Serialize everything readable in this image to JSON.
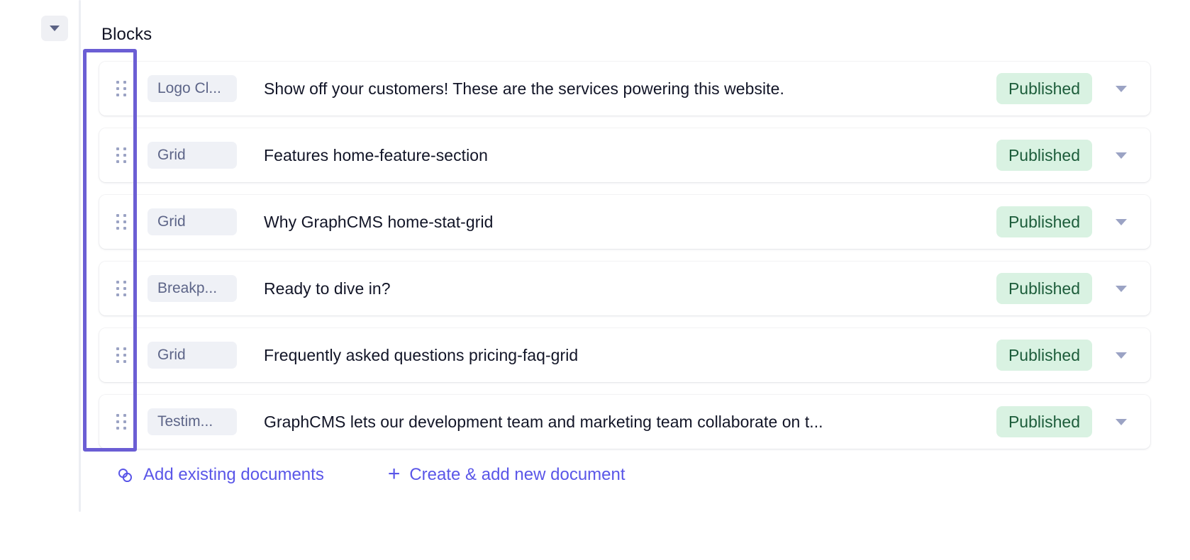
{
  "field": {
    "label": "Blocks",
    "collapse_icon": "triangle-down-icon"
  },
  "rows": [
    {
      "drag_icon": "drag-handle-icon",
      "type": "Logo Cl...",
      "title": "Show off your customers! These are the services powering this website.",
      "status": "Published",
      "menu_icon": "chevron-down-icon"
    },
    {
      "drag_icon": "drag-handle-icon",
      "type": "Grid",
      "title": "Features home-feature-section",
      "status": "Published",
      "menu_icon": "chevron-down-icon"
    },
    {
      "drag_icon": "drag-handle-icon",
      "type": "Grid",
      "title": "Why GraphCMS home-stat-grid",
      "status": "Published",
      "menu_icon": "chevron-down-icon"
    },
    {
      "drag_icon": "drag-handle-icon",
      "type": "Breakp...",
      "title": "Ready to dive in?",
      "status": "Published",
      "menu_icon": "chevron-down-icon"
    },
    {
      "drag_icon": "drag-handle-icon",
      "type": "Grid",
      "title": "Frequently asked questions pricing-faq-grid",
      "status": "Published",
      "menu_icon": "chevron-down-icon"
    },
    {
      "drag_icon": "drag-handle-icon",
      "type": "Testim...",
      "title": "GraphCMS lets our development team and marketing team collaborate on t...",
      "status": "Published",
      "menu_icon": "chevron-down-icon"
    }
  ],
  "actions": {
    "add_existing": {
      "label": "Add existing documents",
      "icon": "link-chain-icon"
    },
    "create_new": {
      "label": "Create & add new document",
      "icon": "plus-icon"
    }
  },
  "colors": {
    "accent": "#5a56e8",
    "annotation": "#6b5ed4",
    "badge_bg": "#d9f2e2",
    "badge_text": "#1c5c3a",
    "chip_bg": "#eff1f6",
    "chip_text": "#5d6588"
  }
}
